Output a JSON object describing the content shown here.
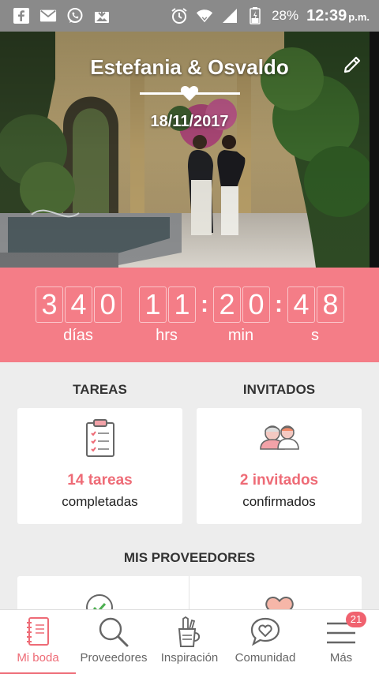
{
  "status_bar": {
    "battery_percent": "28%",
    "time": "12:39",
    "ampm": "p.m."
  },
  "hero": {
    "couple_names": "Estefania & Osvaldo",
    "wedding_date": "18/11/2017"
  },
  "countdown": {
    "days_digits": [
      "3",
      "4",
      "0"
    ],
    "hours_digits": [
      "1",
      "1"
    ],
    "minutes_digits": [
      "2",
      "0"
    ],
    "seconds_digits": [
      "4",
      "8"
    ],
    "separator": ":",
    "labels": {
      "days": "días",
      "hours": "hrs",
      "minutes": "min",
      "seconds": "s"
    }
  },
  "tareas": {
    "title": "TAREAS",
    "count_text": "14 tareas",
    "subtitle": "completadas"
  },
  "invitados": {
    "title": "INVITADOS",
    "count_text": "2 invitados",
    "subtitle": "confirmados"
  },
  "proveedores": {
    "title": "MIS PROVEEDORES"
  },
  "nav": {
    "items": [
      {
        "label": "Mi boda",
        "icon": "notebook-icon",
        "active": true
      },
      {
        "label": "Proveedores",
        "icon": "search-icon",
        "active": false
      },
      {
        "label": "Inspiración",
        "icon": "pencil-cup-icon",
        "active": false
      },
      {
        "label": "Comunidad",
        "icon": "chat-heart-icon",
        "active": false
      },
      {
        "label": "Más",
        "icon": "menu-icon",
        "active": false
      }
    ],
    "badge_count": "21"
  },
  "colors": {
    "accent": "#f47d87",
    "accent_text": "#ee6b76",
    "status_bar": "#8a8a8a"
  }
}
